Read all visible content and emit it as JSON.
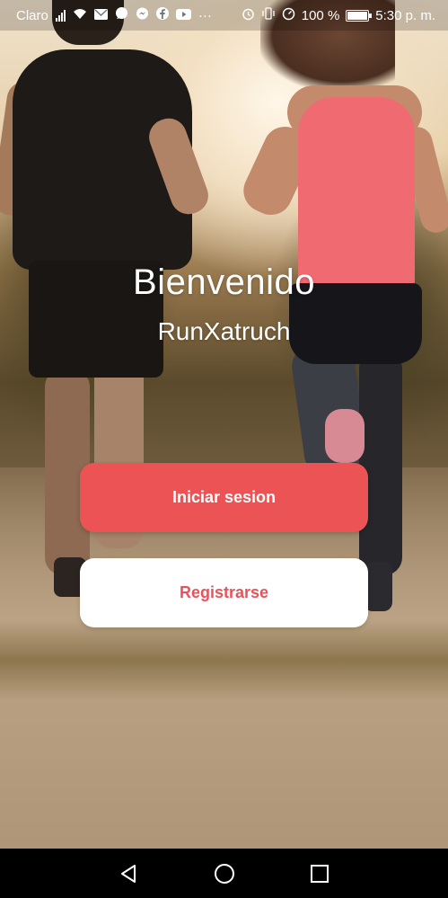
{
  "statusbar": {
    "carrier": "Claro",
    "battery_percent": "100 %",
    "time": "5:30 p. m.",
    "left_icons": [
      "signal-icon",
      "wifi-icon",
      "mail-icon",
      "message-icon",
      "messenger-icon",
      "facebook-icon",
      "youtube-icon",
      "more-icon"
    ],
    "right_icons": [
      "alarm-icon",
      "vibrate-icon",
      "data-saver-icon",
      "battery-icon"
    ]
  },
  "welcome": {
    "title": "Bienvenido",
    "app_name": "RunXatruch"
  },
  "actions": {
    "login_label": "Iniciar sesion",
    "register_label": "Registrarse"
  },
  "colors": {
    "accent": "#eb5354",
    "register_text": "#e9525a"
  },
  "navbar": {
    "buttons": [
      "back-icon",
      "home-icon",
      "recents-icon"
    ]
  }
}
